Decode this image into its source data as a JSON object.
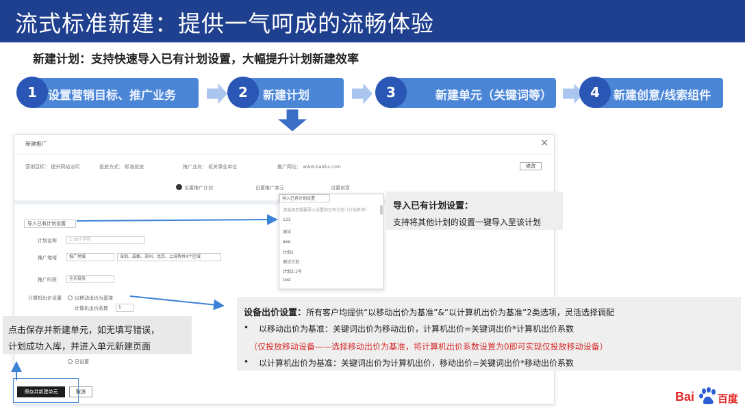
{
  "header": {
    "title": "流式标准新建：提供一气呵成的流畅体验",
    "subtitle": "新建计划：支持快速导入已有计划设置，大幅提升计划新建效率"
  },
  "steps": [
    {
      "num": "1",
      "label": "设置营销目标、推广业务"
    },
    {
      "num": "2",
      "label": "新建计划"
    },
    {
      "num": "3",
      "label": "新建单元（关键词等）"
    },
    {
      "num": "4",
      "label": "新建创意/线索组件"
    }
  ],
  "dialog": {
    "title": "新建推广",
    "close": "×",
    "info": [
      "营销目标：  提升网站访问",
      "投放方式：  标准投放",
      "推广业务：  机关事业单位",
      "推广网址：  www.baidu.com"
    ],
    "edit_button": "修改",
    "steps": [
      "设置推广计划",
      "设置推广单元",
      "设置创意"
    ],
    "import_button": "导入已有计划设置",
    "fields": {
      "plan_name_label": "计划名称",
      "plan_name_placeholder": "1-30个字符",
      "region_label": "推广地域",
      "region_value": "推广地域",
      "region_tags": "深圳、成都、郑州、北京、上海等共4个区域",
      "schedule_label": "推广时段",
      "schedule_value": "全天投放",
      "bid_label": "计算机出价设置",
      "bid_option": "以移动出价为基准",
      "bid_ratio_label": "计算机出价系数",
      "bid_ratio_value": "1",
      "other_radio": "已设置"
    },
    "dropdown": {
      "head": "导入已有计划设置",
      "items": [
        "请选择您想要导入设置的已有计划（计划名称）",
        "123",
        "测试",
        "aaa",
        "计划1",
        "测试计划",
        "计划3.1号",
        "test"
      ]
    },
    "save_button": "保存并新建单元",
    "cancel_button": "取消"
  },
  "callout_import": {
    "title": "导入已有计划设置：",
    "body": "支持将其他计划的设置一键导入至该计划"
  },
  "callout_bid": {
    "title": "设备出价设置：",
    "intro": "所有客户均提供“以移动出价为基准”&“以计算机出价为基准”2类选项，灵活选择调配",
    "line1": "以移动出价为基准：关键词出价为移动出价，计算机出价=关键词出价*计算机出价系数",
    "line2": "（仅投放移动设备——选择移动出价为基准，将计算机出价系数设置为0即可实现仅投放移动设备）",
    "line3": "以计算机出价为基准：关键词出价为计算机出价，移动出价=关键词出价*移动出价系数",
    "bullet": "•"
  },
  "callout_save": {
    "line1": "点击保存并新建单元，如无填写错误，",
    "line2": "计划成功入库，并进入单元新建页面"
  },
  "logo": {
    "bai": "Bai",
    "cn": "百度"
  },
  "colors": {
    "title_bg": "#1f3f8f",
    "step_bar": "#4b86d6",
    "step_circle": "#2a56b5",
    "arrow": "#3b6fc6",
    "highlight_red": "#d62b2b",
    "logo_red": "#e32525"
  }
}
